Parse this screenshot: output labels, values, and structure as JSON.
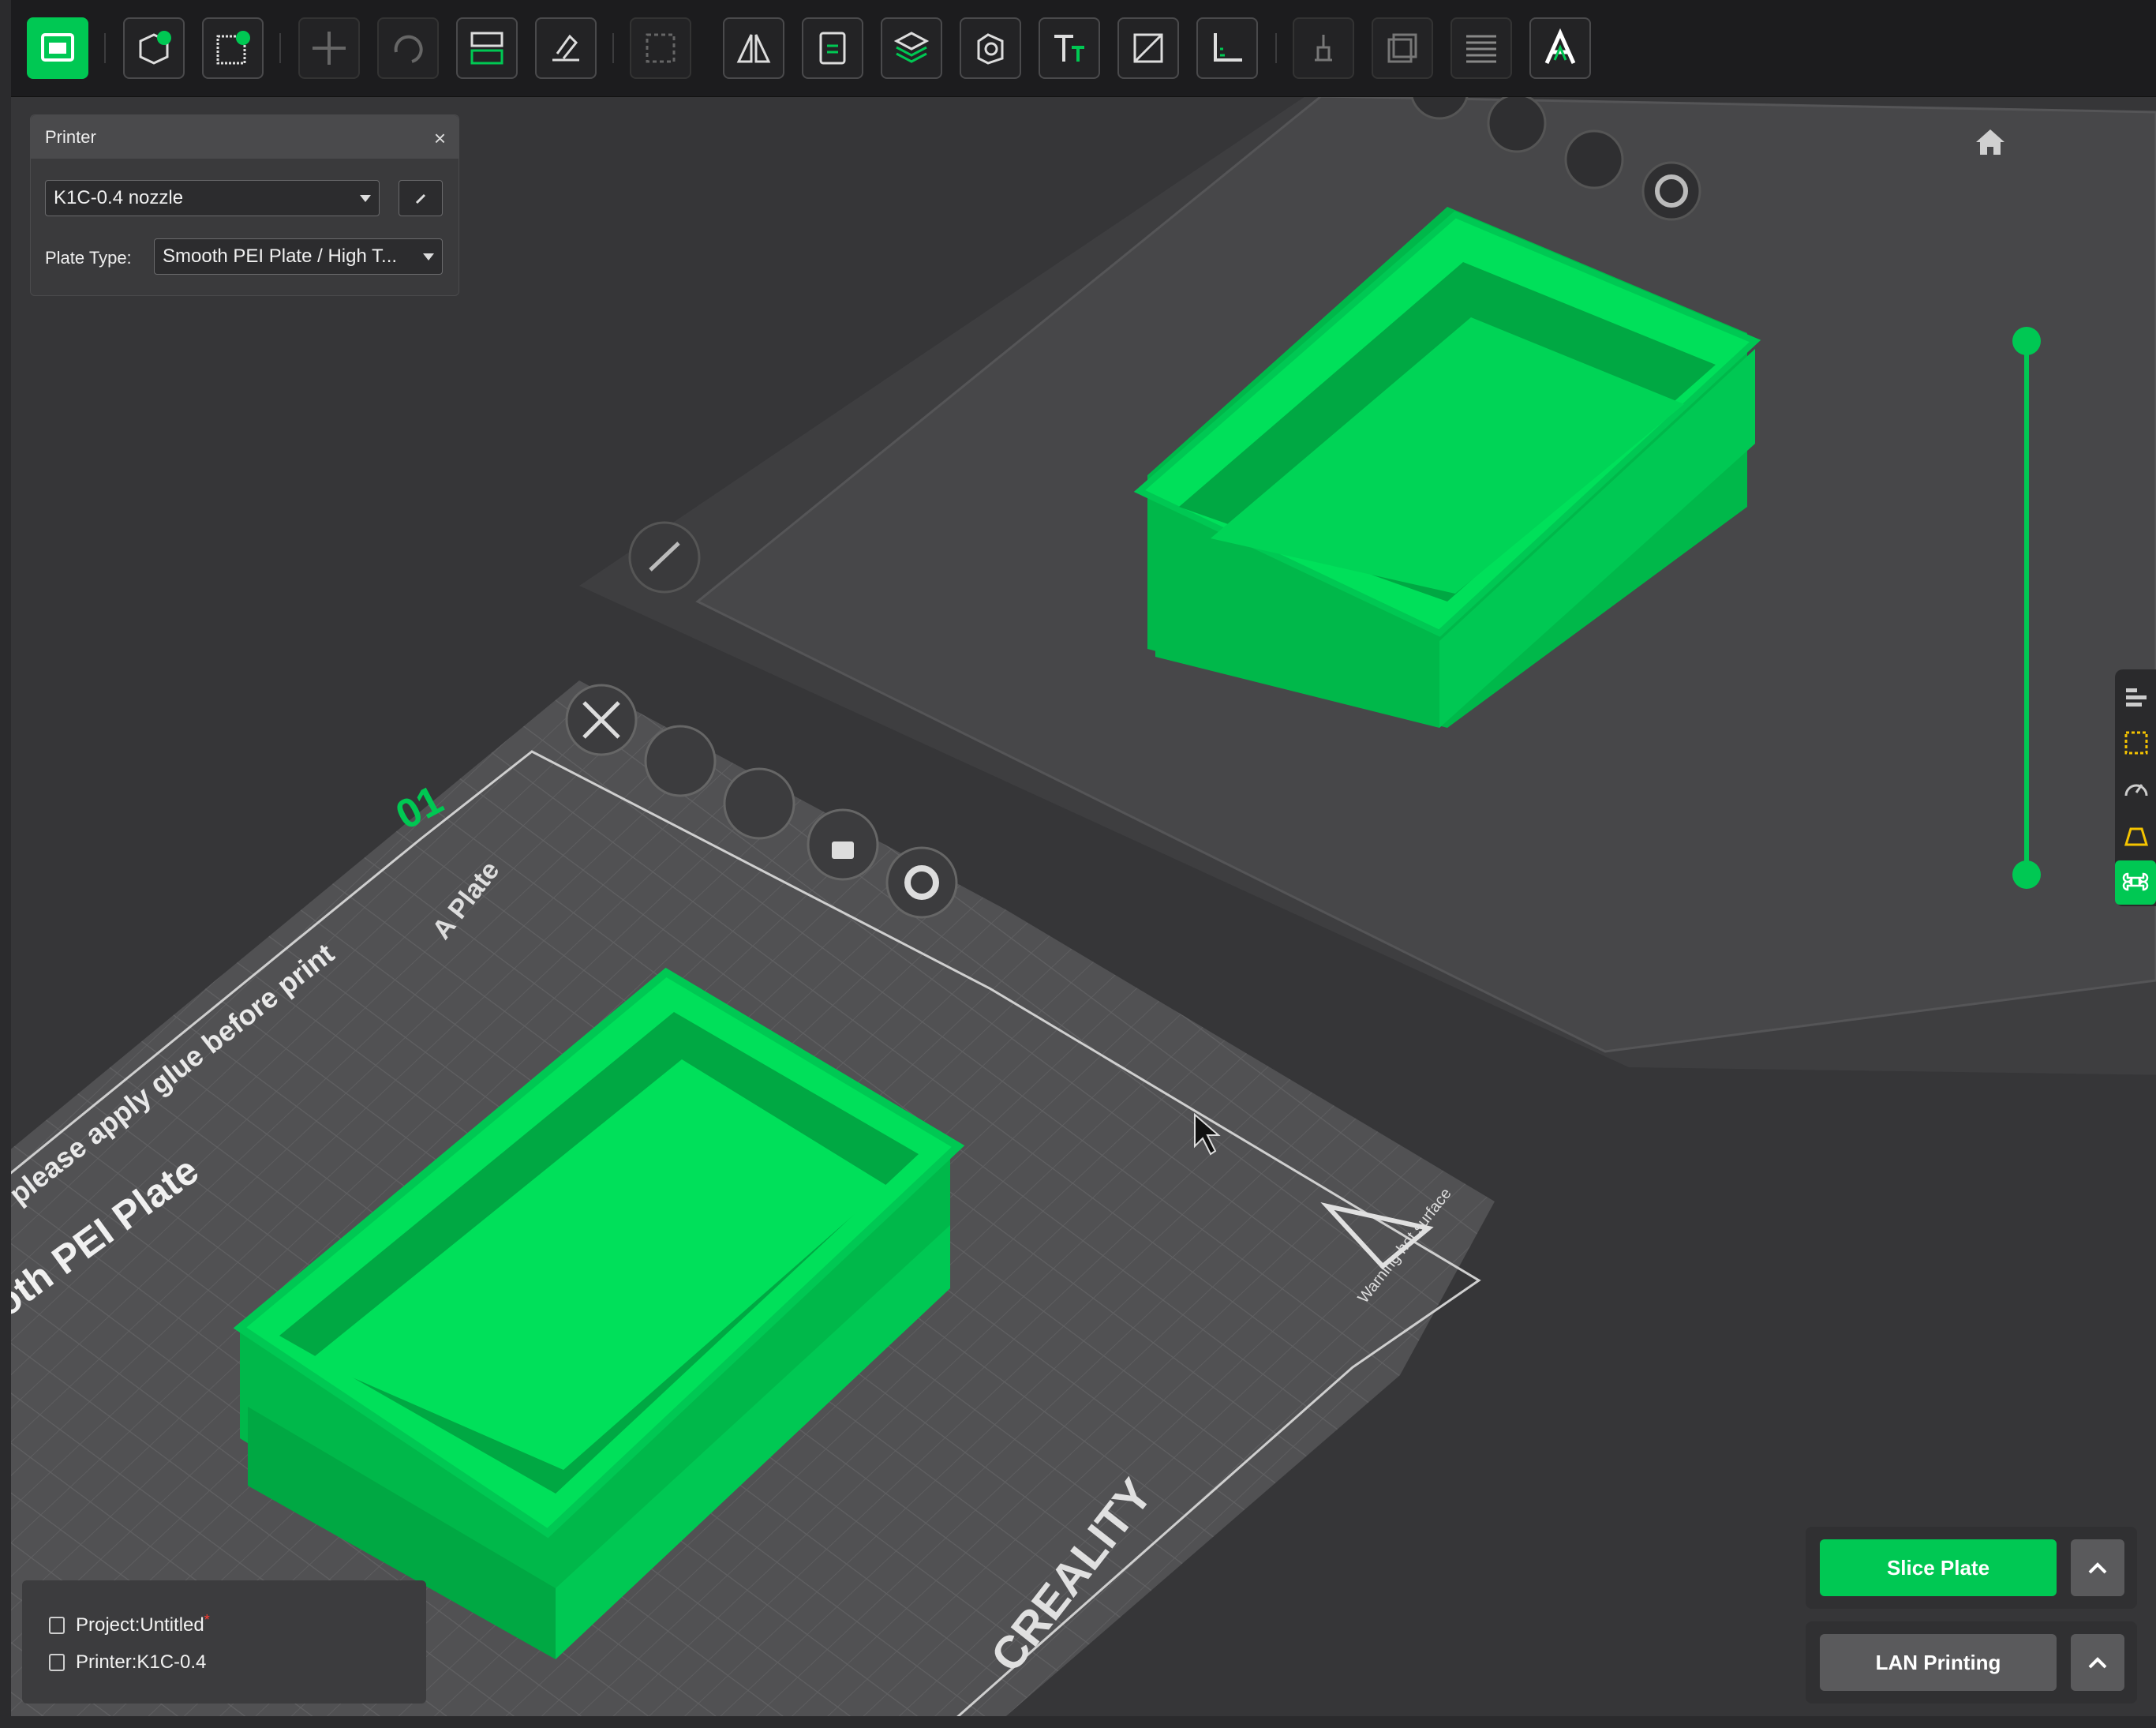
{
  "toolbar": {
    "icons": [
      "plate-icon",
      "add-object-icon",
      "add-plate-icon",
      "move-icon",
      "rotate-icon",
      "arrange-icon",
      "auto-orient-icon",
      "scale-icon",
      "mirror-icon",
      "split-icon",
      "layers-icon",
      "cut-icon",
      "text-icon",
      "support-paint-icon",
      "measure-icon",
      "seam-icon",
      "assembly-icon",
      "variable-layer-icon",
      "font-icon"
    ]
  },
  "printer_panel": {
    "title": "Printer",
    "close_glyph": "×",
    "printer_value": "K1C-0.4 nozzle",
    "plate_type_label": "Plate Type:",
    "plate_type_value": "Smooth PEI Plate / High T..."
  },
  "plates": {
    "plate1_number": "01",
    "plate1_tag": "A Plate",
    "bed_text_glue": "please apply glue before print",
    "bed_text_name": "oth PEI Plate",
    "bed_brand": "CREALITY",
    "warning_text": "Warning hot surface"
  },
  "info": {
    "project": "Project:Untitled",
    "project_dot": "*",
    "printer": "Printer:K1C-0.4"
  },
  "actions": {
    "slice": "Slice Plate",
    "lan": "LAN Printing"
  },
  "colors": {
    "accent": "#00c853",
    "model": "#00e05a",
    "model_dark": "#00a843"
  }
}
